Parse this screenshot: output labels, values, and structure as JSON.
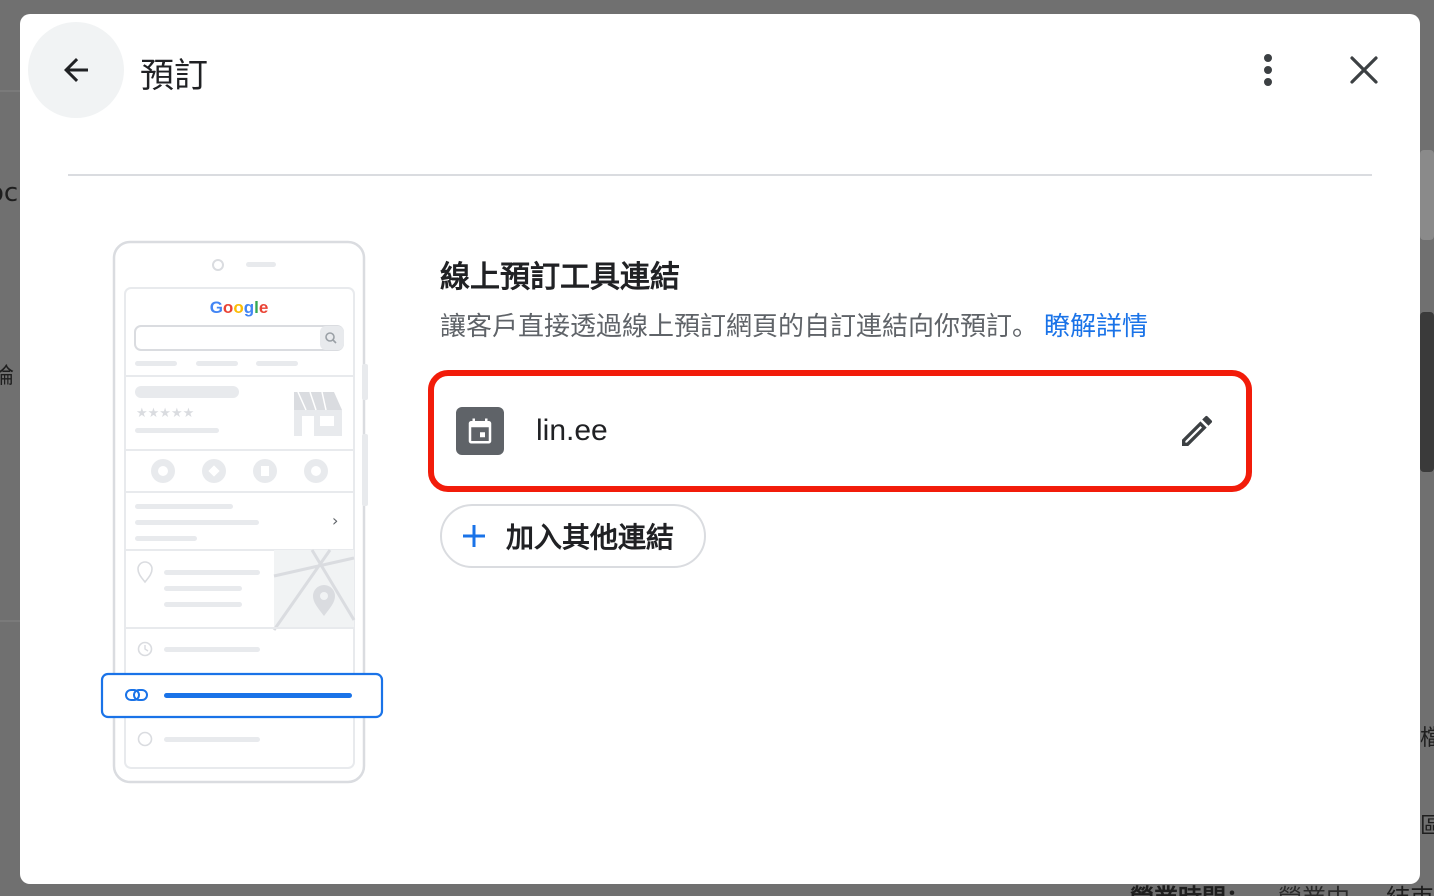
{
  "dialog": {
    "title": "預訂",
    "back_icon": "arrow-back-icon",
    "more_icon": "more-vert-icon",
    "close_icon": "close-icon"
  },
  "illustration": {
    "brand": "Google",
    "rating_stars": "★★★★★",
    "chevron": "›"
  },
  "section": {
    "title": "線上預訂工具連結",
    "description": "讓客戶直接透過線上預訂網頁的自訂連結向你預訂。",
    "learn_more": "瞭解詳情"
  },
  "booking_link": {
    "icon": "calendar-icon",
    "value": "lin.ee",
    "edit_icon": "pencil-edit-icon"
  },
  "add_link": {
    "icon": "plus-icon",
    "label": "加入其他連結"
  },
  "colors": {
    "accent": "#1a73e8",
    "highlight": "#f21c0a",
    "google_blue": "#4285f4",
    "google_red": "#ea4335",
    "google_yellow": "#fbbc05",
    "google_green": "#34a853"
  },
  "background": {
    "glyphs": [
      "oc",
      "論",
      "檔",
      "區",
      "營業時間：",
      "營業中",
      "結束"
    ]
  }
}
